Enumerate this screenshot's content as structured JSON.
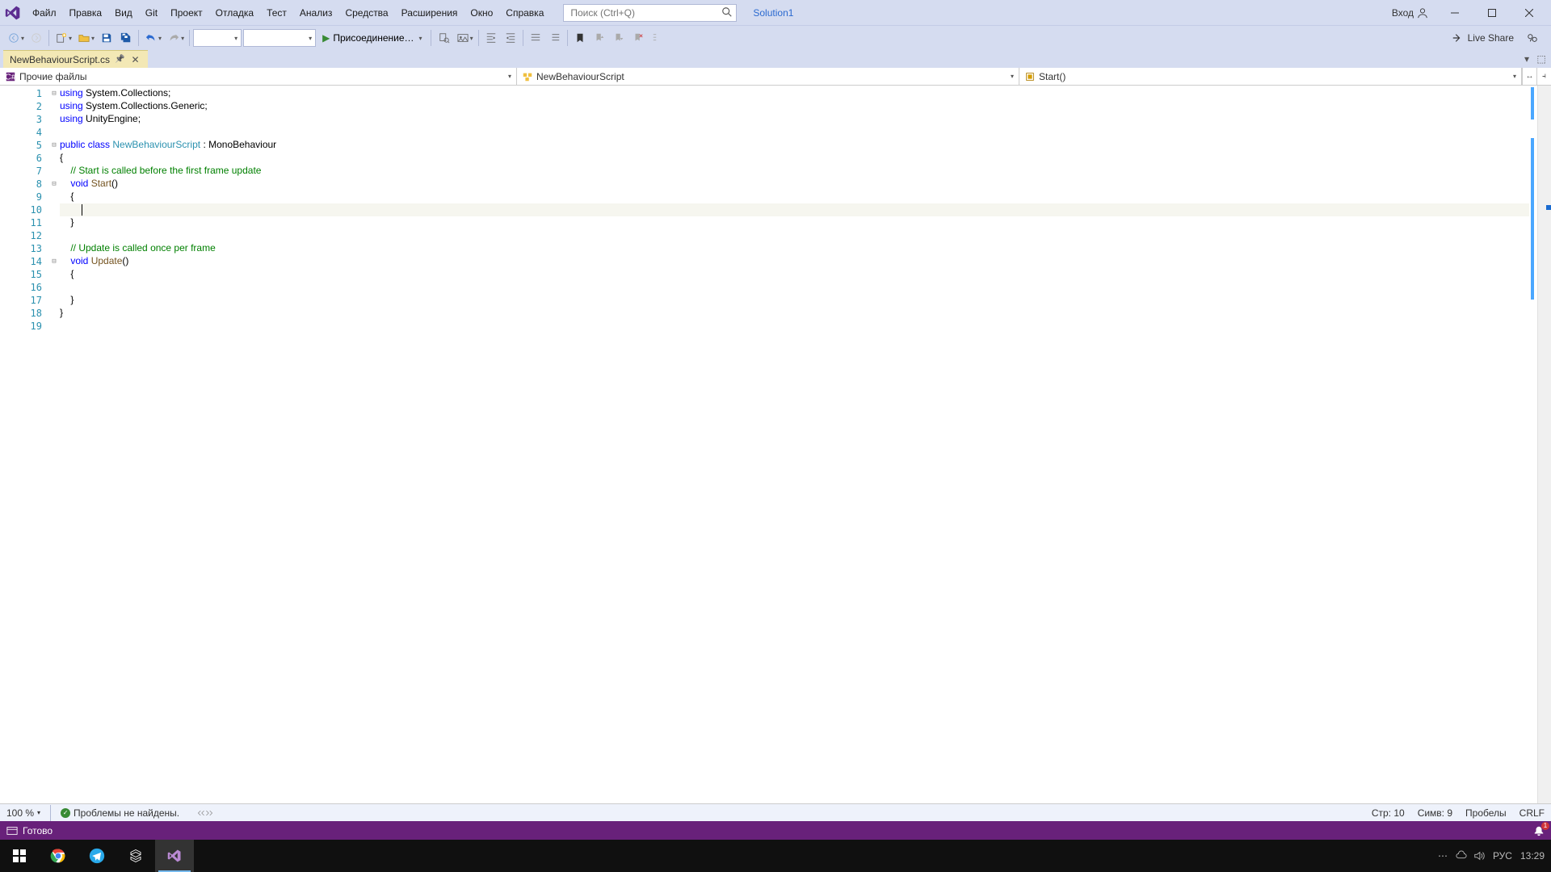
{
  "menubar": {
    "items": [
      "Файл",
      "Правка",
      "Вид",
      "Git",
      "Проект",
      "Отладка",
      "Тест",
      "Анализ",
      "Средства",
      "Расширения",
      "Окно",
      "Справка"
    ],
    "search_placeholder": "Поиск (Ctrl+Q)",
    "solution": "Solution1",
    "login_label": "Вход"
  },
  "toolbar": {
    "run_label": "Присоединение…",
    "live_share": "Live Share"
  },
  "tab": {
    "name": "NewBehaviourScript.cs"
  },
  "nav": {
    "left": "Прочие файлы",
    "middle": "NewBehaviourScript",
    "right": "Start()"
  },
  "code_lines": [
    {
      "n": 1,
      "fold": "-",
      "html": "<span class='kw'>using</span> System.Collections;"
    },
    {
      "n": 2,
      "fold": "",
      "html": "<span class='kw'>using</span> System.Collections.Generic;"
    },
    {
      "n": 3,
      "fold": "",
      "html": "<span class='kw'>using</span> UnityEngine;"
    },
    {
      "n": 4,
      "fold": "",
      "html": ""
    },
    {
      "n": 5,
      "fold": "-",
      "html": "<span class='kw'>public</span> <span class='kw'>class</span> <span class='cls'>NewBehaviourScript</span> : MonoBehaviour"
    },
    {
      "n": 6,
      "fold": "",
      "html": "{"
    },
    {
      "n": 7,
      "fold": "",
      "html": "    <span class='comment'>// Start is called before the first frame update</span>"
    },
    {
      "n": 8,
      "fold": "-",
      "html": "    <span class='kw'>void</span> <span class='method'>Start</span>()"
    },
    {
      "n": 9,
      "fold": "",
      "html": "    {"
    },
    {
      "n": 10,
      "fold": "",
      "html": "        <span class='caret'></span>",
      "hl": true
    },
    {
      "n": 11,
      "fold": "",
      "html": "    }"
    },
    {
      "n": 12,
      "fold": "",
      "html": ""
    },
    {
      "n": 13,
      "fold": "",
      "html": "    <span class='comment'>// Update is called once per frame</span>"
    },
    {
      "n": 14,
      "fold": "-",
      "html": "    <span class='kw'>void</span> <span class='method'>Update</span>()"
    },
    {
      "n": 15,
      "fold": "",
      "html": "    {"
    },
    {
      "n": 16,
      "fold": "",
      "html": "        "
    },
    {
      "n": 17,
      "fold": "",
      "html": "    }"
    },
    {
      "n": 18,
      "fold": "",
      "html": "}"
    },
    {
      "n": 19,
      "fold": "",
      "html": ""
    }
  ],
  "bottom": {
    "zoom": "100 %",
    "issues": "Проблемы не найдены.",
    "line": "Стр: 10",
    "col": "Симв: 9",
    "spaces": "Пробелы",
    "eol": "CRLF"
  },
  "status": {
    "ready": "Готово"
  },
  "tray": {
    "lang": "РУС",
    "time": "13:29"
  }
}
